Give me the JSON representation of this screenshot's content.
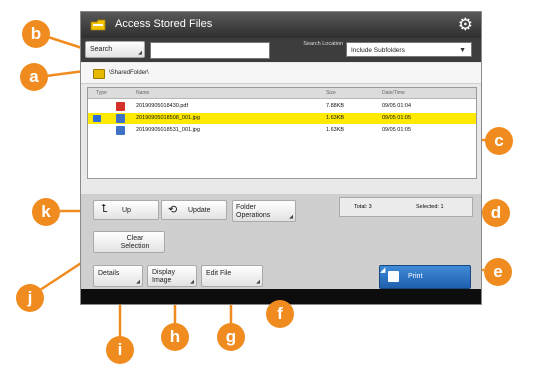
{
  "window": {
    "title": "Access Stored Files"
  },
  "search": {
    "button_label": "Search",
    "input_value": "",
    "location_label": "Search Location",
    "location_selected": "Include Subfolders"
  },
  "path": {
    "text": "\\SharedFolder\\"
  },
  "file_list": {
    "columns": [
      "Type",
      "Name",
      "Size",
      "Date/Time"
    ],
    "rows": [
      {
        "name": "20190905018430.pdf",
        "size": "7.88KB",
        "date": "09/05 01:04",
        "selected": false
      },
      {
        "name": "20190905018508_001.jpg",
        "size": "1.63KB",
        "date": "09/05 01:05",
        "selected": true
      },
      {
        "name": "20190905018531_001.jpg",
        "size": "1.63KB",
        "date": "09/05 01:05",
        "selected": false
      }
    ]
  },
  "nav": {
    "up_label": "Up",
    "update_label": "Update",
    "folder_ops_label": "Folder Operations"
  },
  "counts": {
    "total": "Total: 3",
    "selected": "Selected: 1"
  },
  "actions": {
    "clear_label": "Clear Selection",
    "details_label": "Details",
    "display_label": "Display Image",
    "edit_label": "Edit File",
    "print_label": "Print"
  },
  "callouts": {
    "a": "a",
    "b": "b",
    "c": "c",
    "d": "d",
    "e": "e",
    "f": "f",
    "g": "g",
    "h": "h",
    "i": "i",
    "j": "j",
    "k": "k"
  },
  "colors": {
    "callout": "#f08c1f",
    "selection_highlight": "#ffe900",
    "print_button": "#2f74c4",
    "title_bar": "#3a3a3a"
  }
}
